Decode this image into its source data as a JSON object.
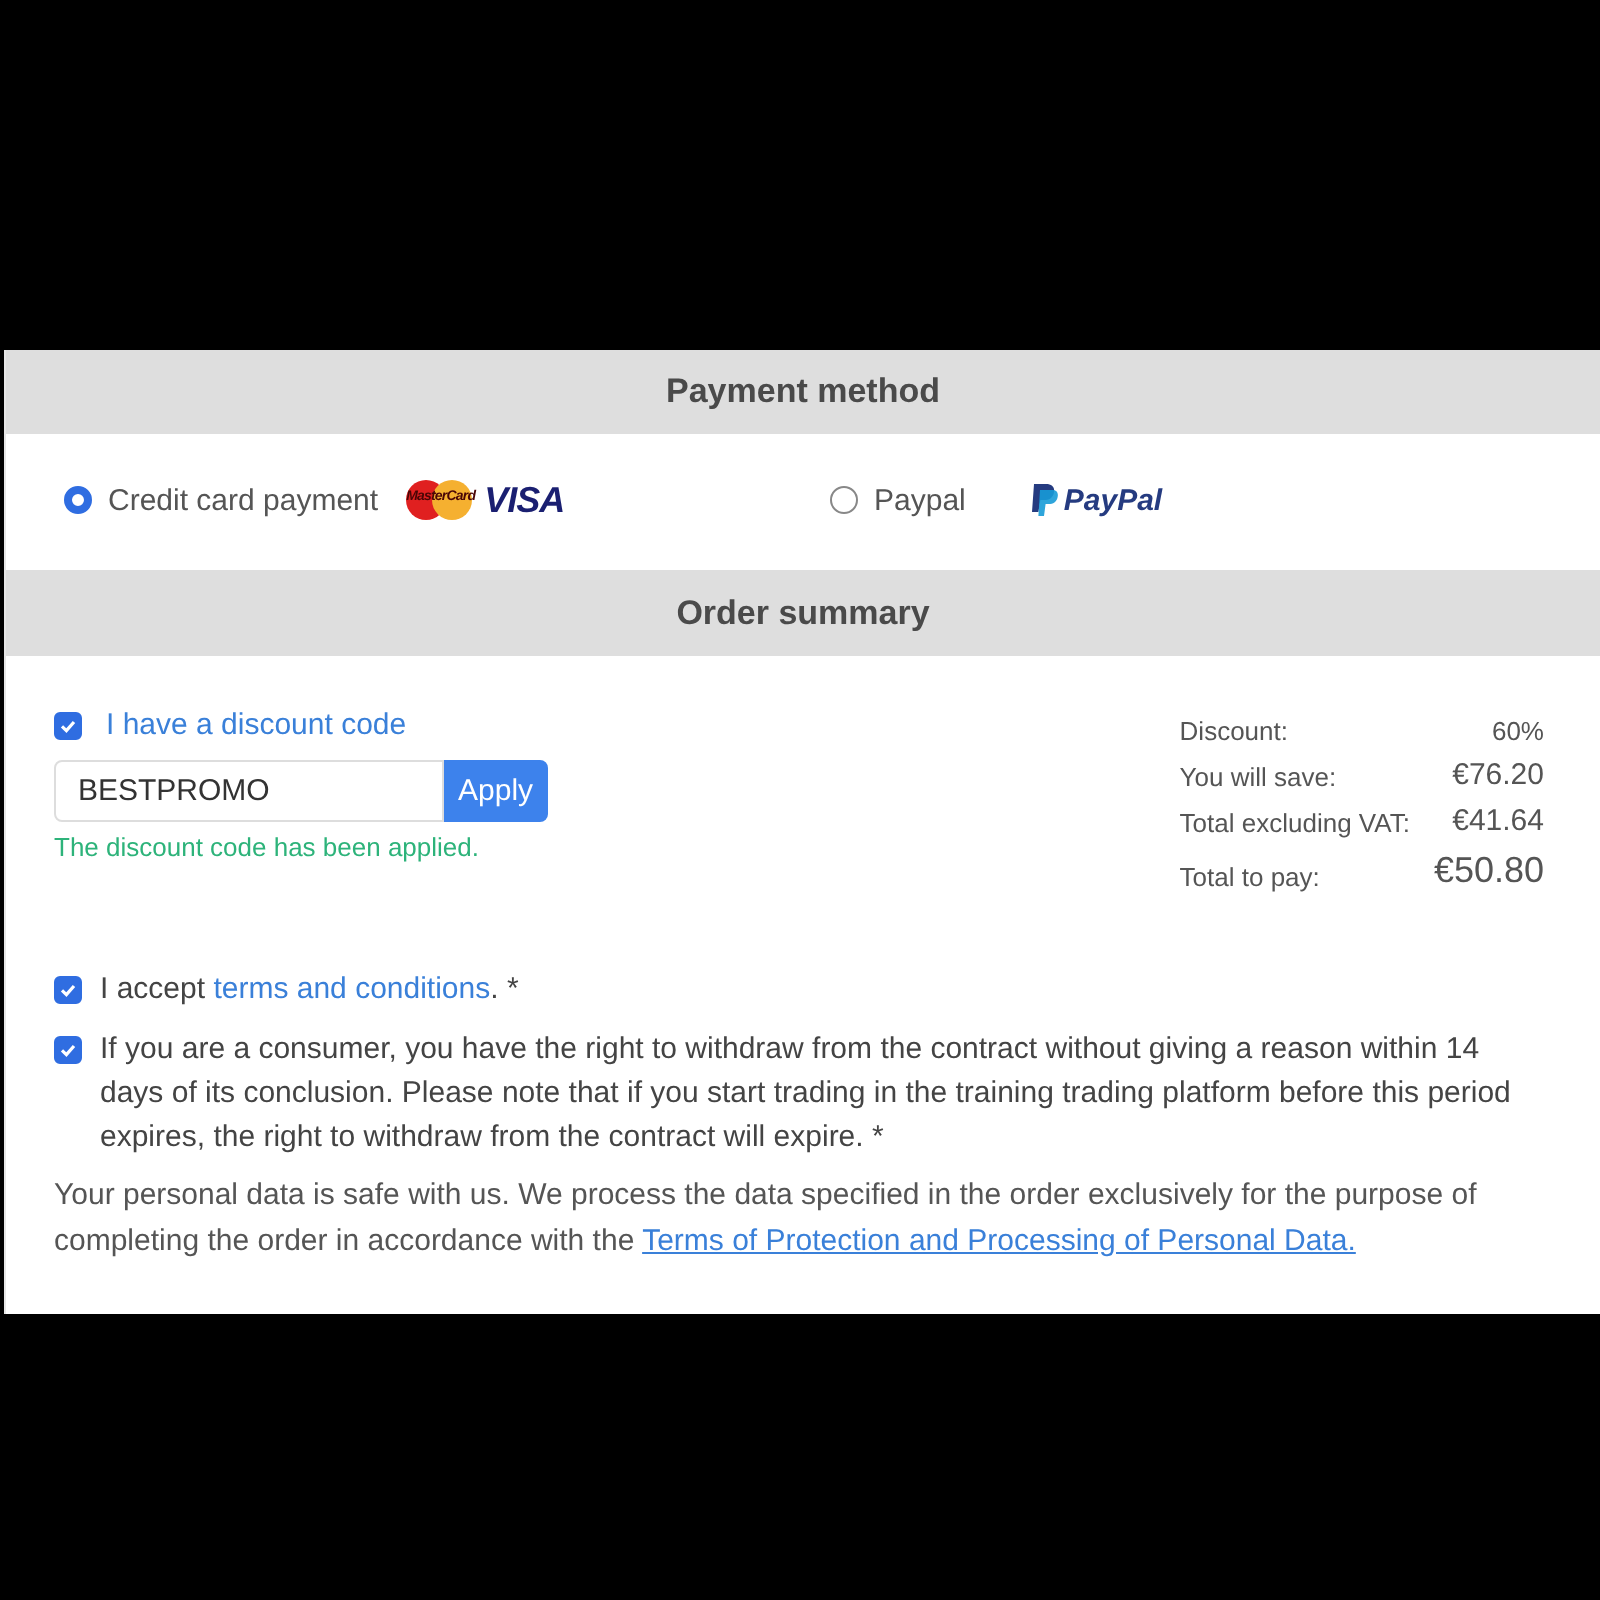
{
  "payment_method": {
    "title": "Payment method",
    "options": [
      {
        "label": "Credit card payment",
        "selected": true,
        "logos": [
          {
            "kind": "mastercard",
            "text": "MasterCard"
          },
          {
            "kind": "visa",
            "text": "VISA"
          }
        ]
      },
      {
        "label": "Paypal",
        "selected": false,
        "logos": [
          {
            "kind": "paypal",
            "text": "PayPal"
          }
        ]
      }
    ]
  },
  "order_summary": {
    "title": "Order summary",
    "discount_toggle": {
      "label": "I have a discount code",
      "checked": true
    },
    "discount_field": {
      "value": "BESTPROMO",
      "button": "Apply",
      "message": "The discount code has been applied."
    },
    "totals": [
      {
        "label": "Discount:",
        "value": "60%",
        "kind": "small"
      },
      {
        "label": "You will save:",
        "value": "€76.20",
        "kind": "normal"
      },
      {
        "label": "Total excluding VAT:",
        "value": "€41.64",
        "kind": "normal"
      },
      {
        "label": "Total to pay:",
        "value": "€50.80",
        "kind": "total"
      }
    ],
    "consents": [
      {
        "checked": true,
        "before": "I accept ",
        "link": "terms and conditions",
        "after": ". *"
      },
      {
        "checked": true,
        "before": "If you are a consumer, you have the right to withdraw from the contract without giving a reason within 14 days of its conclusion. Please note that if you start trading in the training trading platform before this period expires, the right to withdraw from the contract will expire. *"
      }
    ],
    "privacy_note": {
      "before": "Your personal data is safe with us. We process the data specified in the order exclusively for the purpose of completing the order in accordance with the ",
      "link": "Terms of Protection and Processing of Personal Data."
    }
  }
}
